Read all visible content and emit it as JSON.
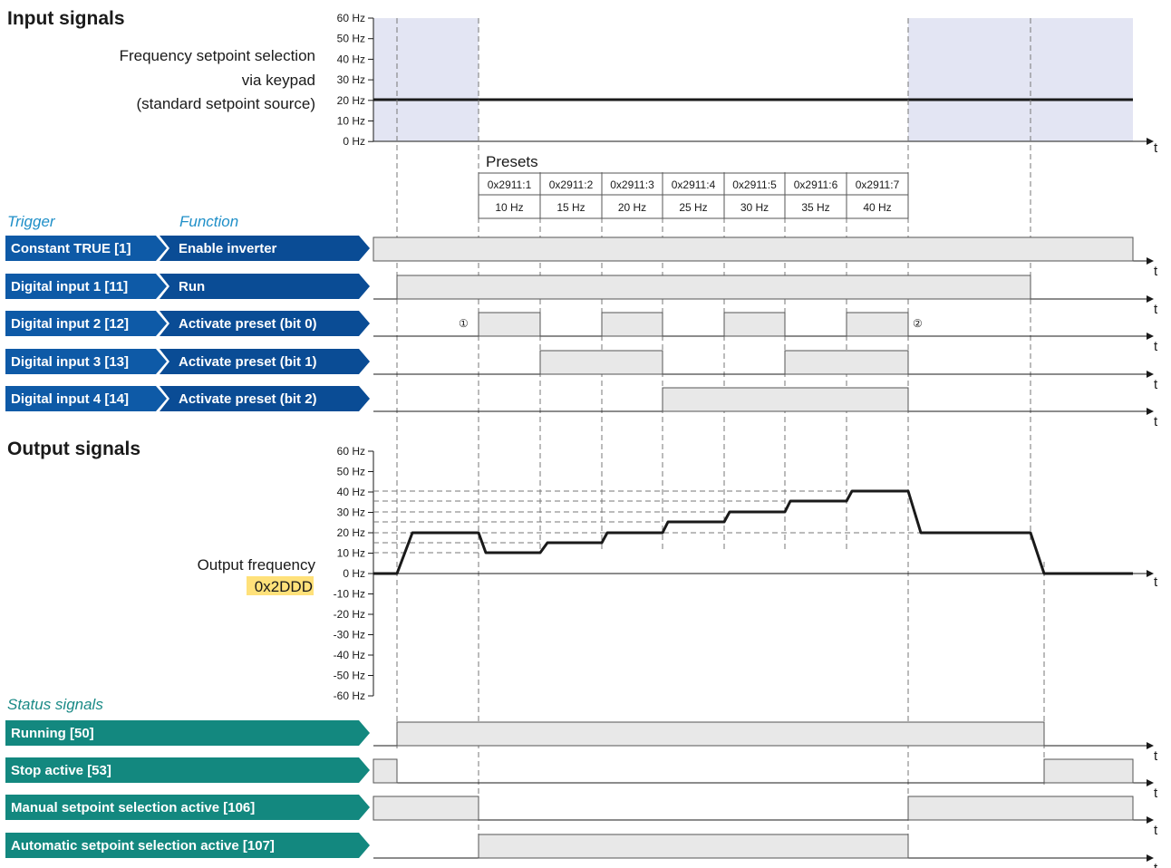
{
  "input_section": {
    "title": "Input signals",
    "setpoint_label": [
      "Frequency setpoint selection",
      "via keypad",
      "(standard setpoint source)"
    ],
    "freq_ticks": [
      "60 Hz",
      "50 Hz",
      "40 Hz",
      "30 Hz",
      "20 Hz",
      "10 Hz",
      "0 Hz"
    ],
    "time_label": "t"
  },
  "presets": {
    "title": "Presets",
    "params": [
      "0x2911:1",
      "0x2911:2",
      "0x2911:3",
      "0x2911:4",
      "0x2911:5",
      "0x2911:6",
      "0x2911:7"
    ],
    "values": [
      "10 Hz",
      "15 Hz",
      "20 Hz",
      "25 Hz",
      "30 Hz",
      "35 Hz",
      "40 Hz"
    ]
  },
  "headers": {
    "trigger": "Trigger",
    "function": "Function",
    "status": "Status signals"
  },
  "triggers": [
    {
      "trigger": "Constant TRUE [1]",
      "function": "Enable inverter"
    },
    {
      "trigger": "Digital input 1 [11]",
      "function": "Run"
    },
    {
      "trigger": "Digital input 2 [12]",
      "function": "Activate preset (bit 0)"
    },
    {
      "trigger": "Digital input 3 [13]",
      "function": "Activate preset (bit 1)"
    },
    {
      "trigger": "Digital input 4 [14]",
      "function": "Activate preset (bit 2)"
    }
  ],
  "markers": [
    "①",
    "②"
  ],
  "output_section": {
    "title": "Output signals",
    "freq_label": "Output frequency",
    "freq_param": "0x2DDD",
    "freq_ticks": [
      "60 Hz",
      "50 Hz",
      "40 Hz",
      "30 Hz",
      "20 Hz",
      "10 Hz",
      "0 Hz",
      "-10 Hz",
      "-20 Hz",
      "-30 Hz",
      "-40 Hz",
      "-50 Hz",
      "-60 Hz"
    ]
  },
  "status": [
    {
      "label": "Running [50]"
    },
    {
      "label": "Stop active [53]"
    },
    {
      "label": "Manual setpoint selection active [106]"
    },
    {
      "label": "Automatic setpoint selection active [107]"
    }
  ],
  "colors": {
    "trigger_blue": "#0e5aa7",
    "function_blue": "#0a4c95",
    "status_teal": "#13887f",
    "signal_fill": "#e8e8e8",
    "highlight_band": "#e3e5f3",
    "param_highlight": "#ffe17a"
  }
}
